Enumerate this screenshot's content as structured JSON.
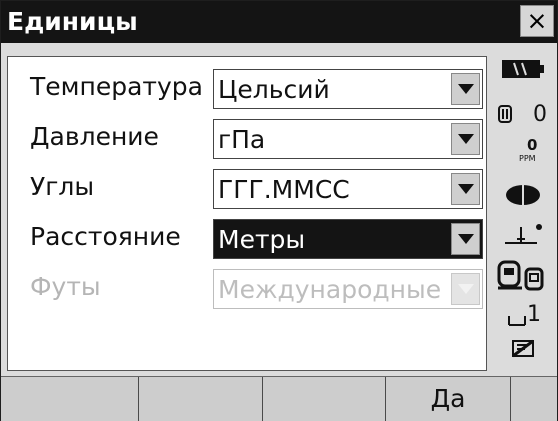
{
  "window": {
    "title": "Единицы",
    "close_label": "×"
  },
  "rows": [
    {
      "label": "Температура",
      "value": "Цельсий",
      "state": "normal"
    },
    {
      "label": "Давление",
      "value": "гПа",
      "state": "normal"
    },
    {
      "label": "Углы",
      "value": "ГГГ.ММСС",
      "state": "normal"
    },
    {
      "label": "Расстояние",
      "value": "Метры",
      "state": "selected"
    },
    {
      "label": "Футы",
      "value": "Международные",
      "state": "disabled"
    }
  ],
  "status": {
    "prism_constant": "0",
    "ppm_value": "0",
    "ppm_unit": "PPM",
    "target_mode": "1",
    "icons": [
      "battery-icon",
      "prism-icon",
      "atmospheric-ppm-icon",
      "laser-pointer-icon",
      "tilt-compensation-icon",
      "communication-icon",
      "target-mode-icon",
      "input-mode-icon"
    ]
  },
  "softkeys": [
    "",
    "",
    "",
    "Да",
    ""
  ],
  "colors": {
    "titlebar": "#141414",
    "selected_row": "#141414",
    "disabled_text": "#bdbdbd"
  }
}
